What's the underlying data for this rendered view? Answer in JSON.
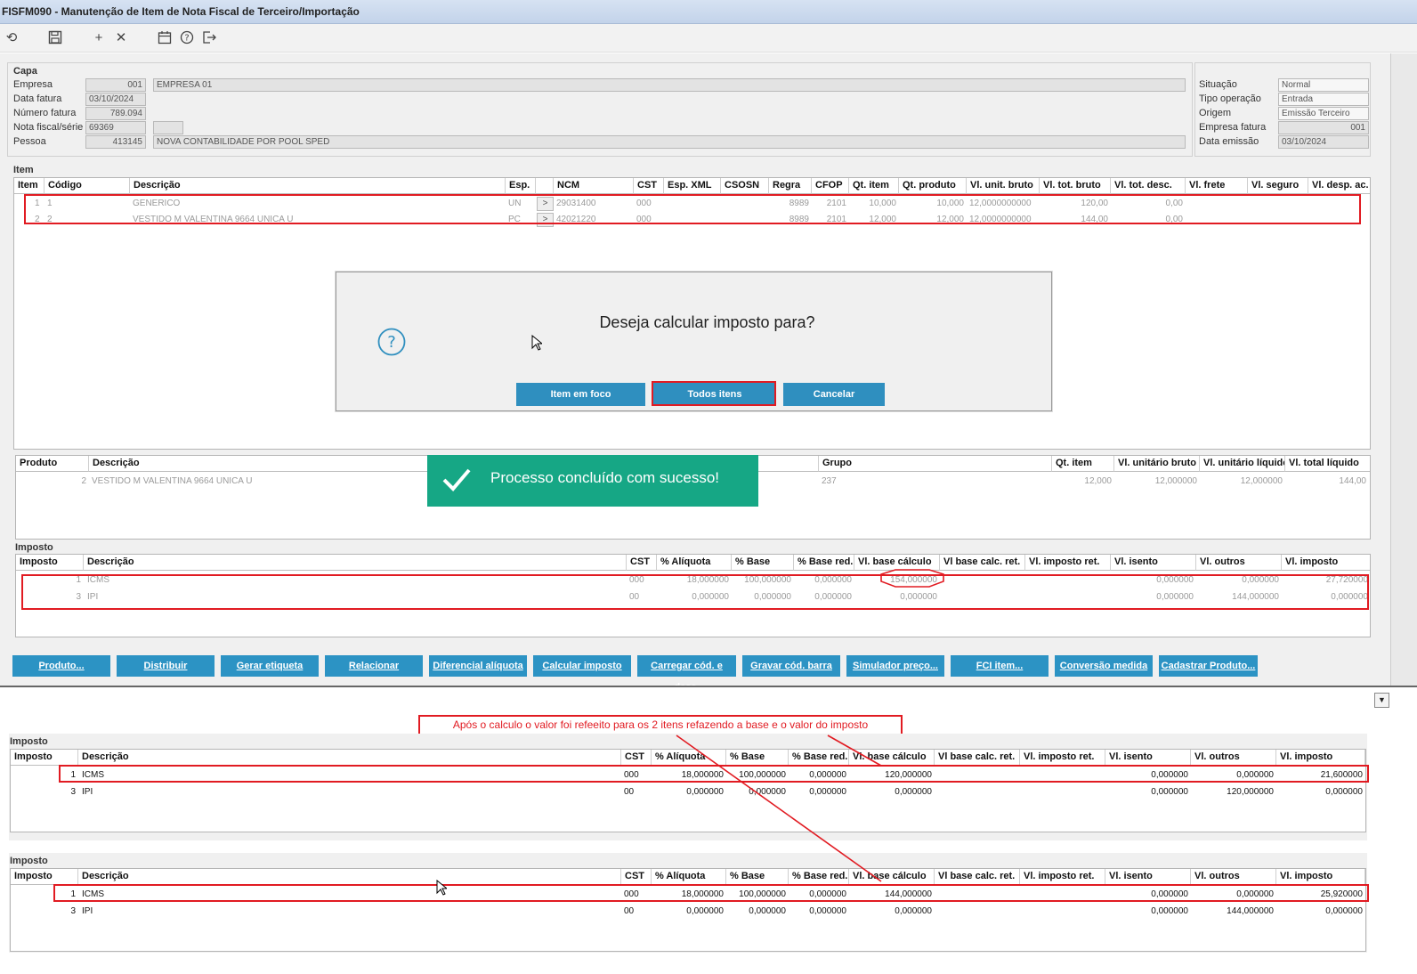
{
  "window": {
    "title": "FISFM090 - Manutenção de Item de Nota Fiscal de Terceiro/Importação"
  },
  "toolbar": {
    "icons": [
      "refresh-icon",
      "save-icon",
      "add-icon",
      "close-icon",
      "calendar-icon",
      "help-icon",
      "exit-icon"
    ]
  },
  "capa": {
    "section": "Capa",
    "empresa_label": "Empresa",
    "empresa_code": "001",
    "empresa_name": "EMPRESA 01",
    "data_fatura_label": "Data fatura",
    "data_fatura": "03/10/2024",
    "numero_fatura_label": "Número fatura",
    "numero_fatura": "789.094",
    "nota_label": "Nota fiscal/série",
    "nota": "69369",
    "serie": "",
    "pessoa_label": "Pessoa",
    "pessoa_code": "413145",
    "pessoa_name": "NOVA CONTABILIDADE POR POOL SPED",
    "situacao_label": "Situação",
    "situacao": "Normal",
    "tipo_label": "Tipo operação",
    "tipo": "Entrada",
    "origem_label": "Origem",
    "origem": "Emissão Terceiro",
    "empresa_fatura_label": "Empresa fatura",
    "empresa_fatura": "001",
    "data_emissao_label": "Data emissão",
    "data_emissao": "03/10/2024"
  },
  "item": {
    "section": "Item",
    "headers": [
      "Item",
      "Código",
      "Descrição",
      "Esp.",
      "",
      "NCM",
      "CST",
      "Esp. XML",
      "CSOSN",
      "Regra",
      "CFOP",
      "Qt. item",
      "Qt. produto",
      "Vl. unit. bruto",
      "Vl. tot. bruto",
      "Vl. tot. desc.",
      "Vl. frete",
      "Vl. seguro",
      "Vl. desp. ac."
    ],
    "rows": [
      [
        "1",
        "1",
        "GENERICO",
        "UN",
        ">",
        "29031400",
        "000",
        "",
        "",
        "8989",
        "2101",
        "10,000",
        "10,000",
        "12,0000000000",
        "120,00",
        "0,00"
      ],
      [
        "2",
        "2",
        "VESTIDO M VALENTINA 9664 UNICA U",
        "PC",
        ">",
        "42021220",
        "000",
        "",
        "",
        "8989",
        "2101",
        "12,000",
        "12,000",
        "12,0000000000",
        "144,00",
        "0,00"
      ]
    ]
  },
  "dialog": {
    "question": "Deseja calcular imposto para?",
    "btn_item": "Item em foco",
    "btn_todos": "Todos itens",
    "btn_cancel": "Cancelar"
  },
  "produto_grid": {
    "headers": [
      "Produto",
      "Descrição",
      "Grupo",
      "Qt. item",
      "Vl. unitário bruto",
      "Vl. unitário líquido",
      "Vl. total líquido"
    ],
    "row": [
      "2",
      "VESTIDO M VALENTINA 9664 UNICA U",
      "237",
      "12,000",
      "12,000000",
      "12,000000",
      "144,00"
    ]
  },
  "toast": {
    "message": "Processo concluído com sucesso!"
  },
  "imposto_top": {
    "section": "Imposto",
    "headers": [
      "Imposto",
      "Descrição",
      "CST",
      "% Alíquota",
      "% Base",
      "% Base red.",
      "Vl. base cálculo",
      "Vl base calc. ret.",
      "Vl. imposto ret.",
      "Vl. isento",
      "Vl. outros",
      "Vl. imposto"
    ],
    "rows": [
      [
        "1",
        "ICMS",
        "000",
        "18,000000",
        "100,000000",
        "0,000000",
        "154,000000",
        "",
        "",
        "0,000000",
        "0,000000",
        "27,720000"
      ],
      [
        "3",
        "IPI",
        "00",
        "0,000000",
        "0,000000",
        "0,000000",
        "0,000000",
        "",
        "",
        "0,000000",
        "144,000000",
        "0,000000"
      ]
    ]
  },
  "actions": [
    "Produto...",
    "Distribuir",
    "Gerar etiqueta",
    "Relacionar",
    "Diferencial alíquota",
    "Calcular imposto",
    "Carregar cód. e desc.",
    "Gravar cód. barra",
    "Simulador preço...",
    "FCI item...",
    "Conversão medida",
    "Cadastrar Produto..."
  ],
  "annotation": "Após o calculo o valor foi refeeito para os 2 itens refazendo a base e o valor do imposto",
  "imposto_after1": {
    "section": "Imposto",
    "headers": [
      "Imposto",
      "Descrição",
      "CST",
      "% Alíquota",
      "% Base",
      "% Base red.",
      "Vl. base cálculo",
      "Vl base calc. ret.",
      "Vl. imposto ret.",
      "Vl. isento",
      "Vl. outros",
      "Vl. imposto"
    ],
    "rows": [
      [
        "1",
        "ICMS",
        "000",
        "18,000000",
        "100,000000",
        "0,000000",
        "120,000000",
        "",
        "",
        "0,000000",
        "0,000000",
        "21,600000"
      ],
      [
        "3",
        "IPI",
        "00",
        "0,000000",
        "0,000000",
        "0,000000",
        "0,000000",
        "",
        "",
        "0,000000",
        "120,000000",
        "0,000000"
      ]
    ]
  },
  "imposto_after2": {
    "section": "Imposto",
    "headers": [
      "Imposto",
      "Descrição",
      "CST",
      "% Alíquota",
      "% Base",
      "% Base red.",
      "Vl. base cálculo",
      "Vl base calc. ret.",
      "Vl. imposto ret.",
      "Vl. isento",
      "Vl. outros",
      "Vl. imposto"
    ],
    "rows": [
      [
        "1",
        "ICMS",
        "000",
        "18,000000",
        "100,000000",
        "0,000000",
        "144,000000",
        "",
        "",
        "0,000000",
        "0,000000",
        "25,920000"
      ],
      [
        "3",
        "IPI",
        "00",
        "0,000000",
        "0,000000",
        "0,000000",
        "0,000000",
        "",
        "",
        "0,000000",
        "144,000000",
        "0,000000"
      ]
    ]
  },
  "colors": {
    "accent": "#2c93c4",
    "success": "#16a785",
    "highlight": "#e11b22"
  }
}
